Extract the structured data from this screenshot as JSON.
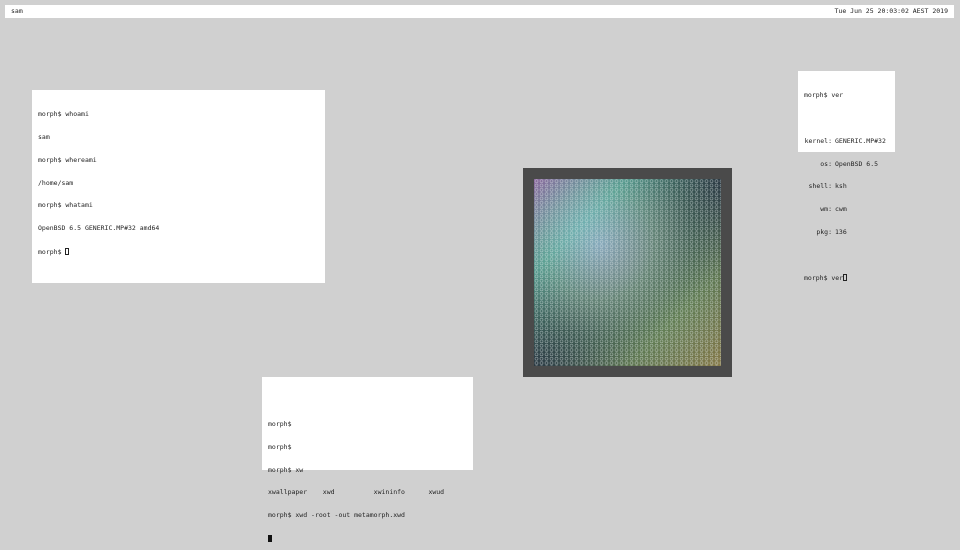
{
  "topbar": {
    "workspace_label": "sam",
    "datetime": "Tue Jun 25 20:03:02 AEST 2019"
  },
  "terminal_main": {
    "lines": [
      "morph$ whoami",
      "sam",
      "morph$ whereami",
      "/home/sam",
      "morph$ whatami",
      "OpenBSD 6.5 GENERIC.MP#32 amd64"
    ],
    "prompt": "morph$ "
  },
  "terminal_sysinfo": {
    "command_line": "morph$ ver",
    "rows": [
      {
        "key": "kernel:",
        "value": "GENERIC.MP#32"
      },
      {
        "key": "os:",
        "value": "OpenBSD 6.5"
      },
      {
        "key": "shell:",
        "value": "ksh"
      },
      {
        "key": "wm:",
        "value": "cwm"
      },
      {
        "key": "pkg:",
        "value": "136"
      }
    ],
    "prompt_line": "morph$ ver"
  },
  "terminal_xwd": {
    "lines": [
      "morph$",
      "morph$",
      "morph$ xw",
      "xwallpaper    xwd          xwininfo      xwud",
      "morph$ xwd -root -out metamorph.xwd"
    ]
  },
  "image_viewer": {
    "content": "iridescent-honeycomb-sphere"
  }
}
